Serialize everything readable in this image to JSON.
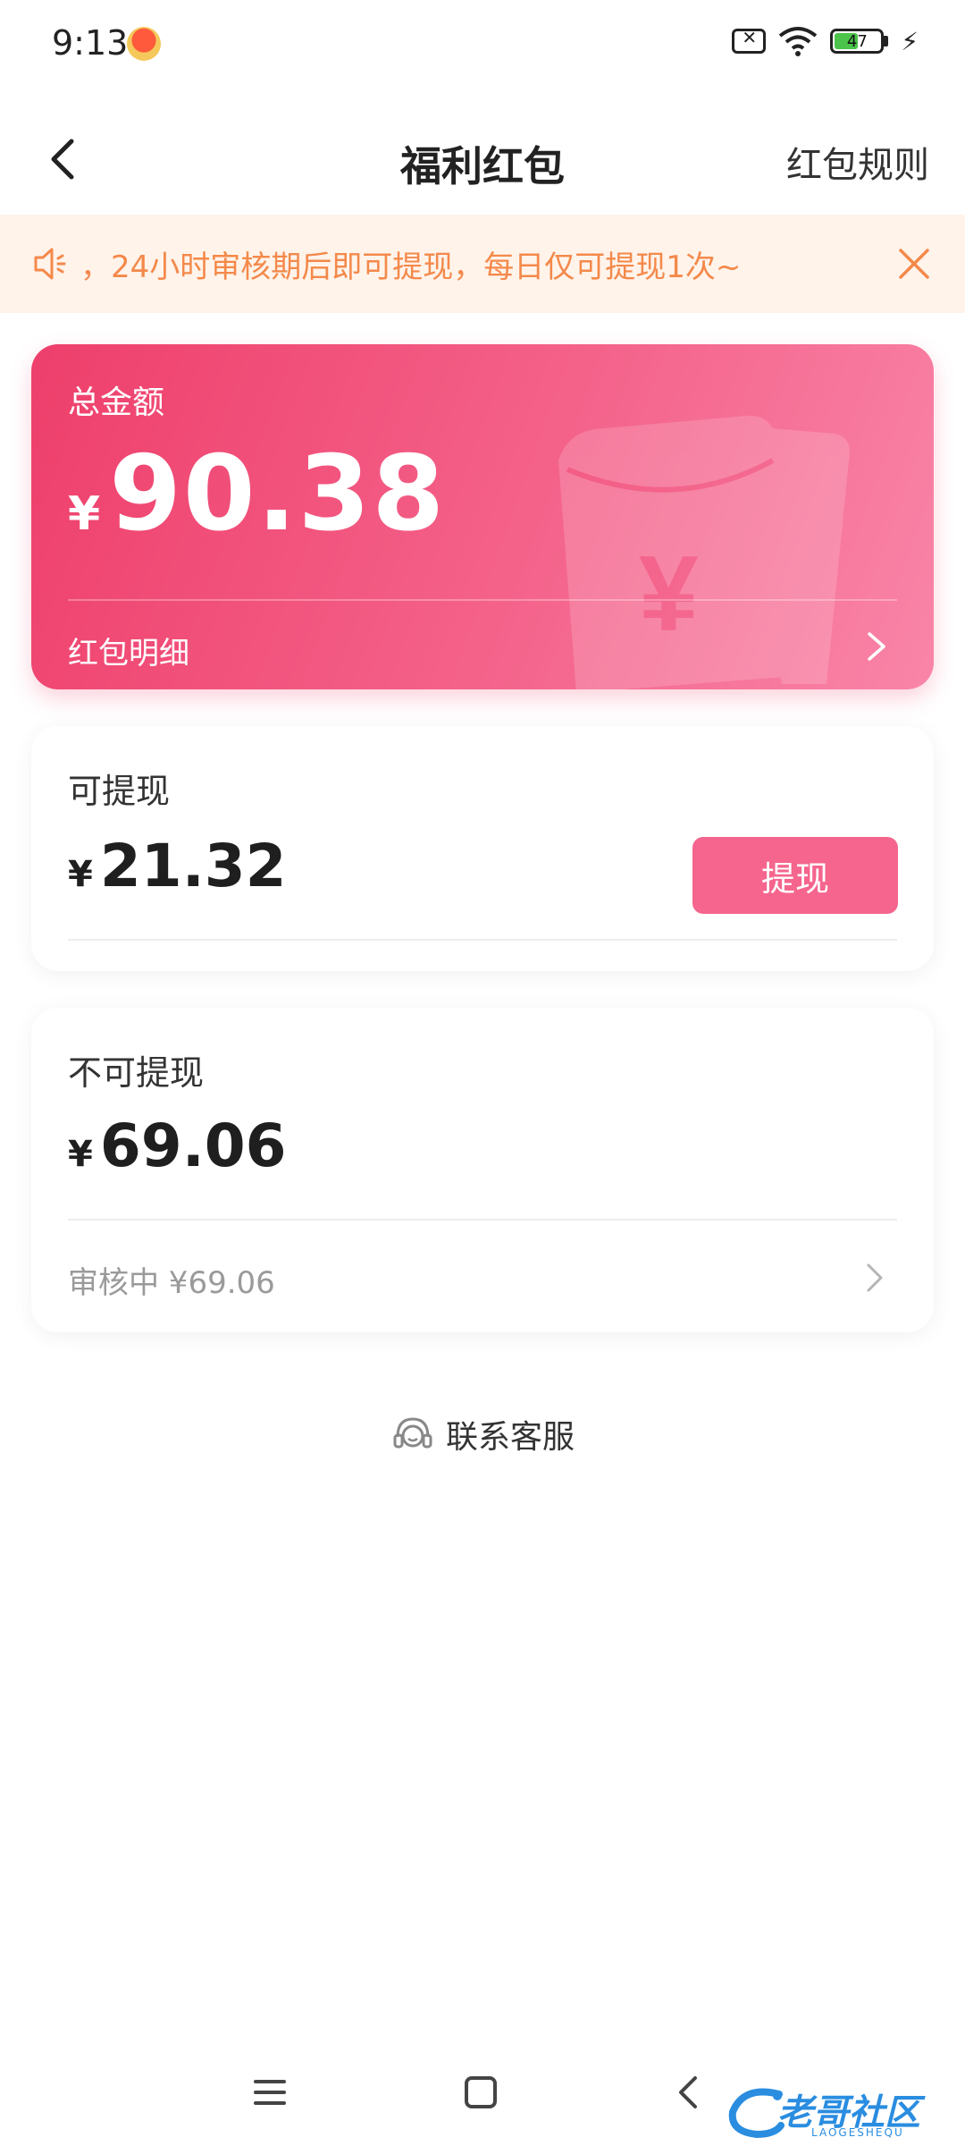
{
  "status_bar": {
    "time": "9:13",
    "battery": "47"
  },
  "header": {
    "title": "福利红包",
    "rules_link": "红包规则"
  },
  "notice": {
    "text": "，24小时审核期后即可提现，每日仅可提现1次~"
  },
  "total_card": {
    "label": "总金额",
    "currency": "¥",
    "amount": "90.38",
    "detail_label": "红包明细"
  },
  "withdrawable": {
    "label": "可提现",
    "currency": "¥",
    "amount": "21.32",
    "button_label": "提现"
  },
  "non_withdrawable": {
    "label": "不可提现",
    "currency": "¥",
    "amount": "69.06",
    "review_text": "审核中 ¥69.06"
  },
  "support": {
    "label": "联系客服"
  },
  "watermark": {
    "text": "老哥社区",
    "sub": "LAOGESHEQU"
  },
  "colors": {
    "brand_pink": "#f5658d",
    "notice_orange": "#f4894a",
    "notice_bg": "#fff3ea",
    "card_gradient_start": "#ee3f6b",
    "card_gradient_end": "#f985a8"
  },
  "icons": {
    "back": "chevron-left-icon",
    "notice": "speaker-icon",
    "close": "close-icon",
    "detail": "chevron-right-icon",
    "support": "headset-icon"
  }
}
